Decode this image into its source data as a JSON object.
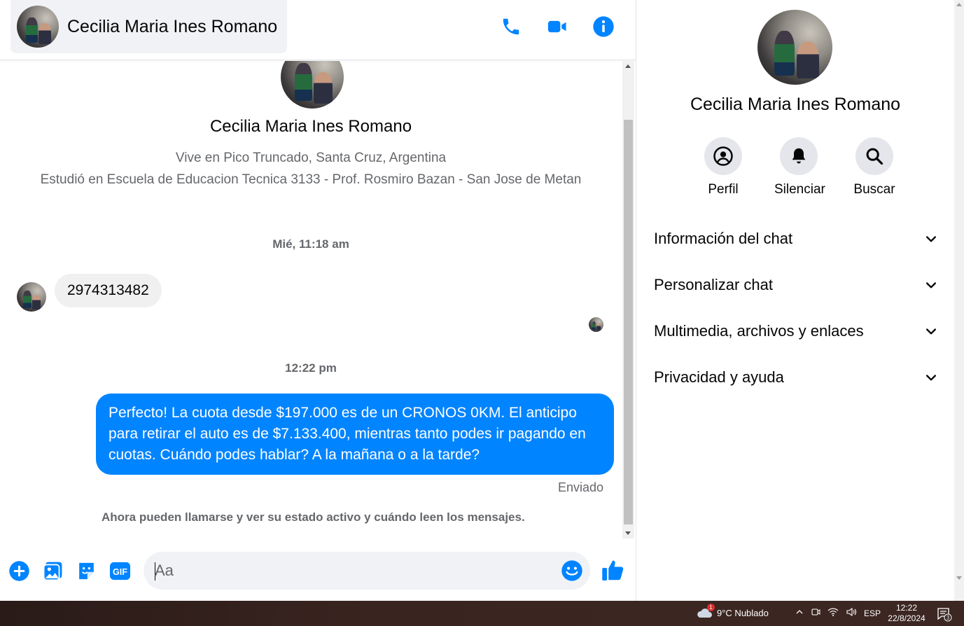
{
  "contact": {
    "name": "Cecilia Maria Ines Romano",
    "lives_in": "Vive en Pico Truncado, Santa Cruz, Argentina",
    "studied_at": "Estudió en Escuela de Educacion Tecnica 3133 - Prof. Rosmiro Bazan - San Jose de Metan"
  },
  "messages": {
    "timestamp_1": "Mié, 11:18 am",
    "incoming_1": "2974313482",
    "timestamp_2": "12:22 pm",
    "outgoing_1": "Perfecto! La cuota desde $197.000 es de un CRONOS 0KM. El anticipo para retirar el auto es de $7.133.400, mientras tanto podes ir pagando en cuotas. Cuándo podes hablar? A la mañana o a la tarde?",
    "sent_status": "Enviado",
    "notice": "Ahora pueden llamarse y ver su estado activo y cuándo leen los mensajes."
  },
  "composer": {
    "placeholder": "Aa",
    "gif_label": "GIF"
  },
  "info_panel": {
    "actions": [
      {
        "label": "Perfil",
        "icon": "profile-icon"
      },
      {
        "label": "Silenciar",
        "icon": "bell-icon"
      },
      {
        "label": "Buscar",
        "icon": "search-icon"
      }
    ],
    "sections": [
      "Información del chat",
      "Personalizar chat",
      "Multimedia, archivos y enlaces",
      "Privacidad y ayuda"
    ]
  },
  "taskbar": {
    "weather": "9°C  Nublado",
    "weather_badge": "1",
    "language": "ESP",
    "time": "12:22",
    "date": "22/8/2024",
    "notifications": "3"
  },
  "colors": {
    "accent": "#0084ff",
    "bubble_in": "#f0f0f0",
    "secondary_text": "#65676b"
  }
}
